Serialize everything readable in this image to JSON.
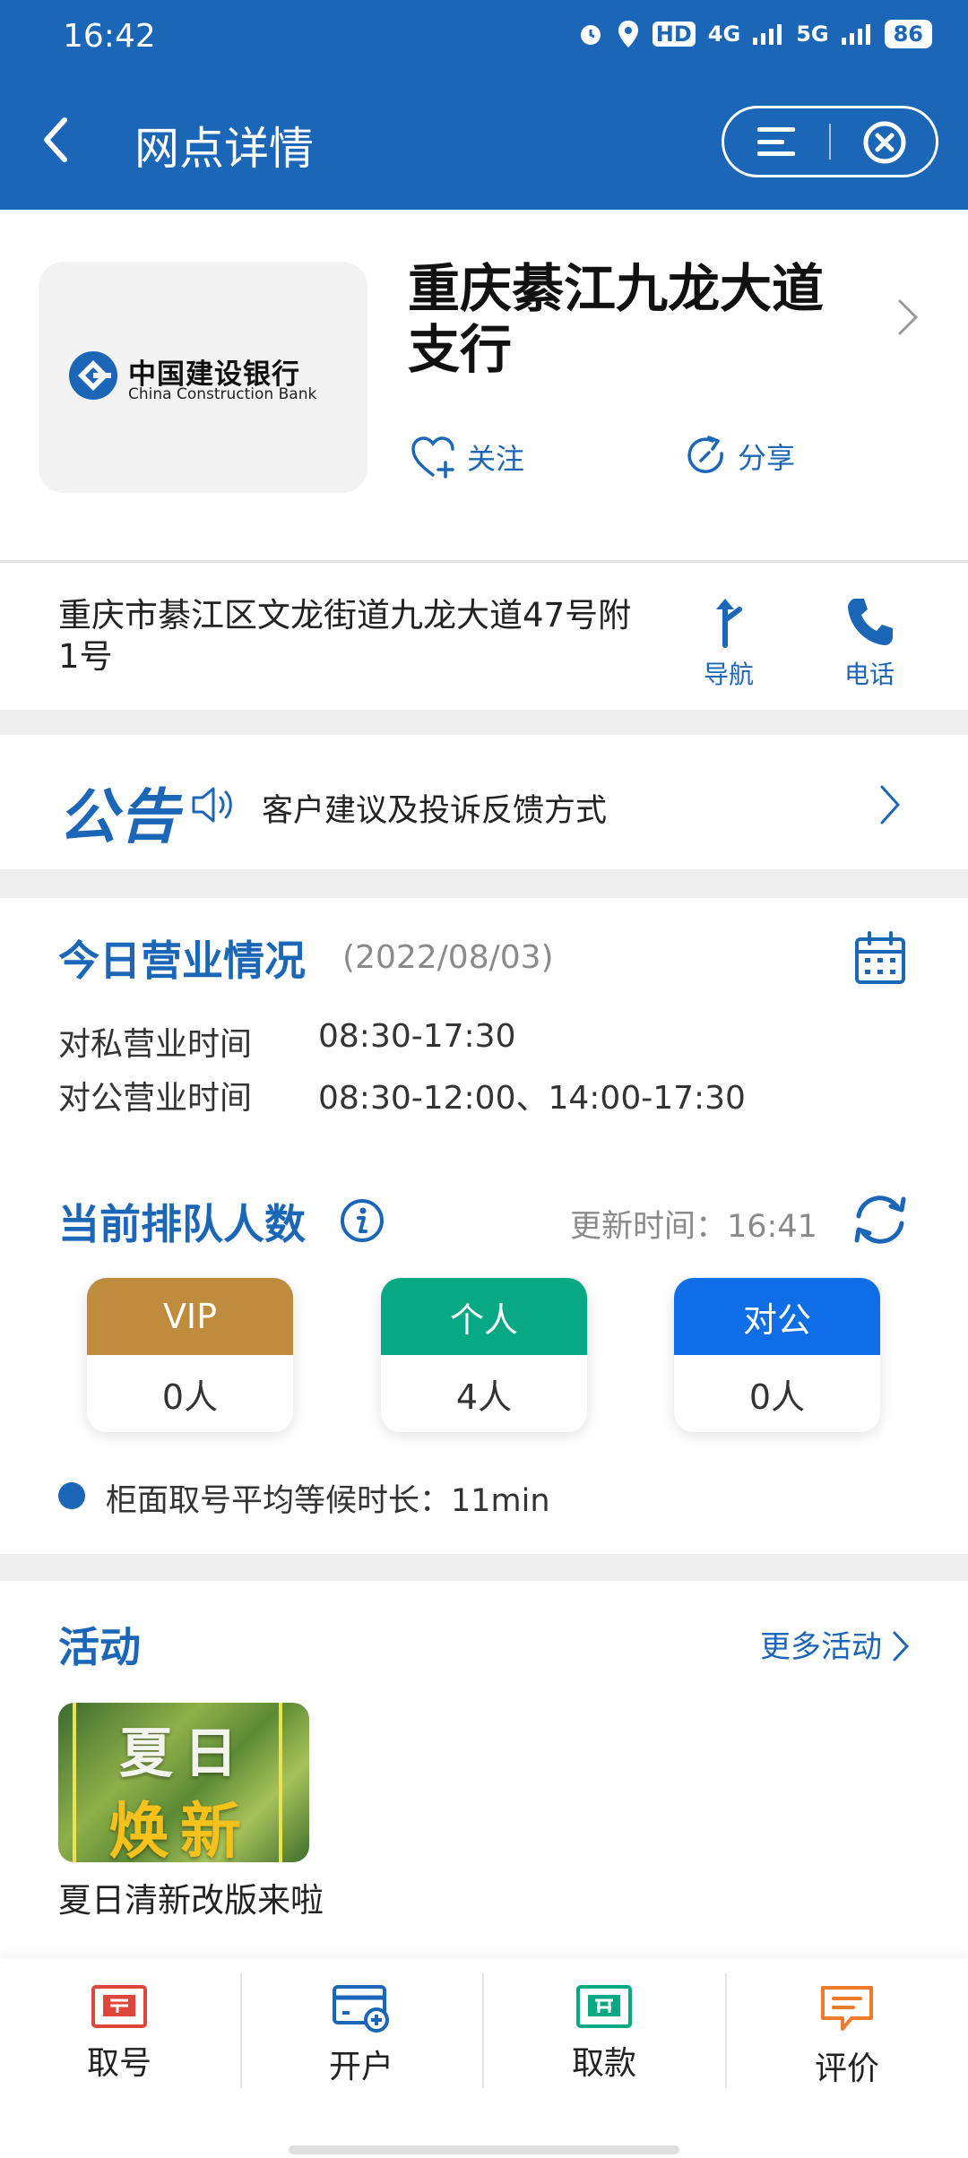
{
  "status_bar": {
    "time": "16:42",
    "signal_4g": "4G",
    "signal_5g": "5G",
    "hd": "HD",
    "battery": "86"
  },
  "header": {
    "title": "网点详情",
    "back_icon": "chevron-left-icon",
    "menu_icon": "menu-icon",
    "close_icon": "close-icon",
    "bg_color": "#1c66b8"
  },
  "branch": {
    "name": "重庆綦江九龙大道支行",
    "logo_text_cn": "中国建设银行",
    "logo_text_en": "China Construction Bank",
    "follow_label": "关注",
    "share_label": "分享",
    "address": "重庆市綦江区文龙街道九龙大道47号附1号",
    "nav_label": "导航",
    "phone_label": "电话"
  },
  "announcement": {
    "label": "公告",
    "text": "客户建议及投诉反馈方式"
  },
  "business": {
    "title": "今日营业情况",
    "date": "(2022/08/03)",
    "hours": [
      {
        "label": "对私营业时间",
        "value": "08:30-17:30"
      },
      {
        "label": "对公营业时间",
        "value": "08:30-12:00、14:00-17:30"
      }
    ]
  },
  "queue": {
    "title": "当前排队人数",
    "update_time": "更新时间：16:41",
    "cards": [
      {
        "name": "VIP",
        "value": "0人",
        "color": "#bf8b3c"
      },
      {
        "name": "个人",
        "value": "4人",
        "color": "#07a884"
      },
      {
        "name": "对公",
        "value": "0人",
        "color": "#0f6ee6"
      }
    ],
    "avg_wait": "柜面取号平均等候时长：11min"
  },
  "activities": {
    "title": "活动",
    "more_label": "更多活动",
    "image_text_top": "夏日",
    "image_text_bottom": "焕新",
    "caption": "夏日清新改版来啦"
  },
  "bottom_tabs": [
    {
      "label": "取号",
      "icon": "take-number-icon",
      "color": "#e0453b"
    },
    {
      "label": "开户",
      "icon": "open-account-icon",
      "color": "#1c66b8"
    },
    {
      "label": "取款",
      "icon": "withdraw-icon",
      "color": "#07a884"
    },
    {
      "label": "评价",
      "icon": "review-icon",
      "color": "#ee7a2c"
    }
  ]
}
